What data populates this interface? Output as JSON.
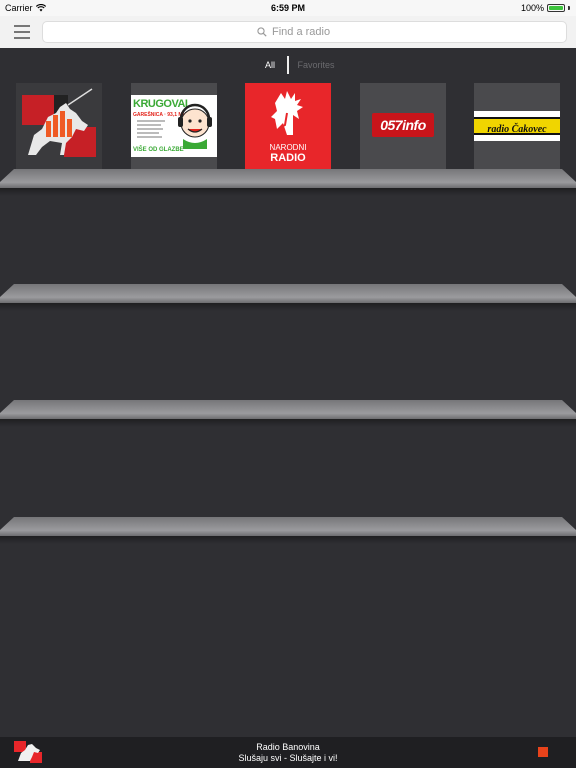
{
  "status_bar": {
    "carrier": "Carrier",
    "time": "6:59 PM",
    "battery": "100%",
    "battery_level": 1.0,
    "battery_color": "#3dc43d"
  },
  "nav": {
    "menu_icon": "hamburger-menu-icon",
    "search_icon": "search-icon",
    "search_placeholder": "Find a radio",
    "search_value": ""
  },
  "filter": {
    "all_label": "All",
    "favorites_label": "Favorites",
    "selected": "All"
  },
  "stations": [
    {
      "name": "Radio Banovina",
      "logo": "knight-on-horse-equalizer-logo"
    },
    {
      "name": "Krugoval",
      "logo_lines": [
        "KRUGOVAL",
        "GAREŠNICA · 93,1 MHz",
        "VIŠE OD GLAZBE"
      ]
    },
    {
      "name": "Narodni Radio",
      "logo_lines": [
        "NARODNI",
        "RADIO"
      ],
      "logo": "rooster-logo"
    },
    {
      "name": "057info",
      "logo_text": "057info"
    },
    {
      "name": "Radio Čakovec",
      "logo_text": "radio Čakovec"
    }
  ],
  "player": {
    "station": "Radio Banovina",
    "slogan": "Slušaju svi - Slušajte i vi!",
    "logo": "radio-banovina-logo",
    "stop_icon": "stop-icon",
    "accent": "#e8431b"
  },
  "colors": {
    "background": "#2f2f33",
    "navbar": "#f2f2f2",
    "player": "#1f1f22",
    "narodni_red": "#e8262a",
    "info_red": "#c8141a",
    "cakovec_yellow": "#f0d500"
  }
}
